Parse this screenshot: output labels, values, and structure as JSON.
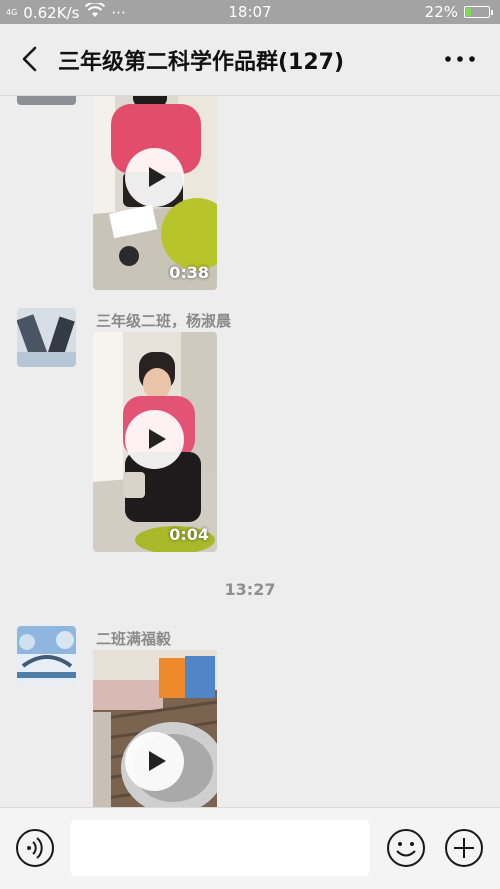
{
  "status_bar": {
    "signal": "4G",
    "speed": "0.62K/s",
    "dots": "···",
    "time": "18:07",
    "battery": "22%",
    "battery_level": 0.22,
    "battery_color": "#7ed957"
  },
  "header": {
    "title": "三年级第二科学作品群(127)",
    "back_icon": "chevron-left-icon",
    "more_icon": "more-horizontal-icon"
  },
  "messages": [
    {
      "sender": "",
      "video_duration": "0:38"
    },
    {
      "sender": "三年级二班，杨淑晨",
      "video_duration": "0:04"
    },
    {
      "timestamp": "13:27"
    },
    {
      "sender": "二班满福毅",
      "video_duration": ""
    }
  ],
  "input_bar": {
    "voice_icon": "voice-icon",
    "placeholder": "",
    "emoji_icon": "emoji-icon",
    "plus_icon": "plus-icon"
  }
}
